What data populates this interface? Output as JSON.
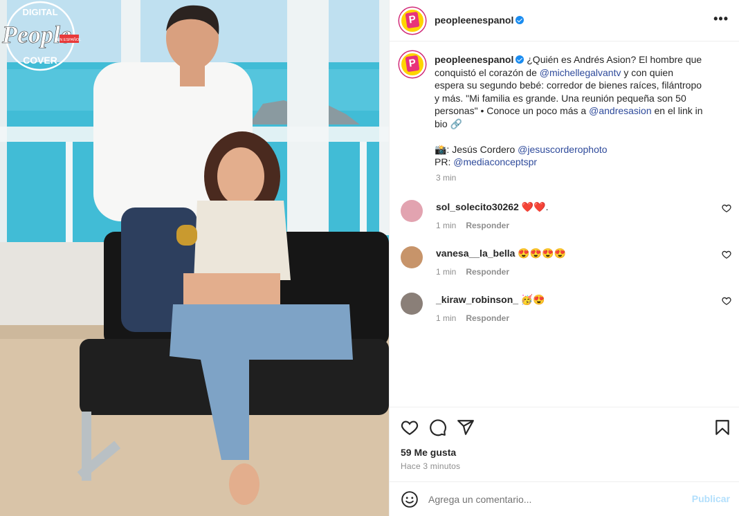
{
  "post": {
    "username": "peopleenespanol",
    "more_label": "•••",
    "avatar_letter": "P",
    "badge": {
      "top": "DIGITAL",
      "main": "People",
      "sub": "EN ESPAÑOL",
      "bottom": "COVER"
    }
  },
  "caption": {
    "username": "peopleenespanol",
    "line1": " ¿Quién es Andrés Asion? El hombre que",
    "line2a": "conquistó el corazón de ",
    "mention1": "@michellegalvantv",
    "line2b": " y con quien",
    "line3": "espera su segundo bebé: corredor de bienes raíces, filántropo",
    "line4": "y más. \"Mi familia es grande. Una reunión pequeña son 50",
    "line5a": "personas\" • Conoce un poco más a ",
    "mention2": "@andresasion",
    "line5b": " en el link in",
    "line6": "bio 🔗",
    "credit_photo": "📸: Jesús Cordero ",
    "mention3": "@jesuscorderophoto",
    "credit_pr": "PR: ",
    "mention4": "@mediaconceptspr",
    "time": "3 min"
  },
  "comments": [
    {
      "user": "sol_solecito30262",
      "text": " ❤️❤️.",
      "time": "1 min",
      "reply": "Responder",
      "avatar_color": "#e2a3b0"
    },
    {
      "user": "vanesa__la_bella",
      "text": " 😍😍😍😍",
      "time": "1 min",
      "reply": "Responder",
      "avatar_color": "#c7946a"
    },
    {
      "user": "_kiraw_robinson_",
      "text": " 🥳😍",
      "time": "1 min",
      "reply": "Responder",
      "avatar_color": "#8a7f78"
    }
  ],
  "actions": {
    "likes": "59 Me gusta",
    "ago": "Hace 3 minutos"
  },
  "add_comment": {
    "placeholder": "Agrega un comentario...",
    "publish": "Publicar"
  },
  "colors": {
    "brand_yellow": "#ffd400",
    "brand_pink": "#e8327a",
    "link": "#2e4a9b",
    "verified": "#1a8cf0",
    "publish_disabled": "#b2dffc"
  }
}
